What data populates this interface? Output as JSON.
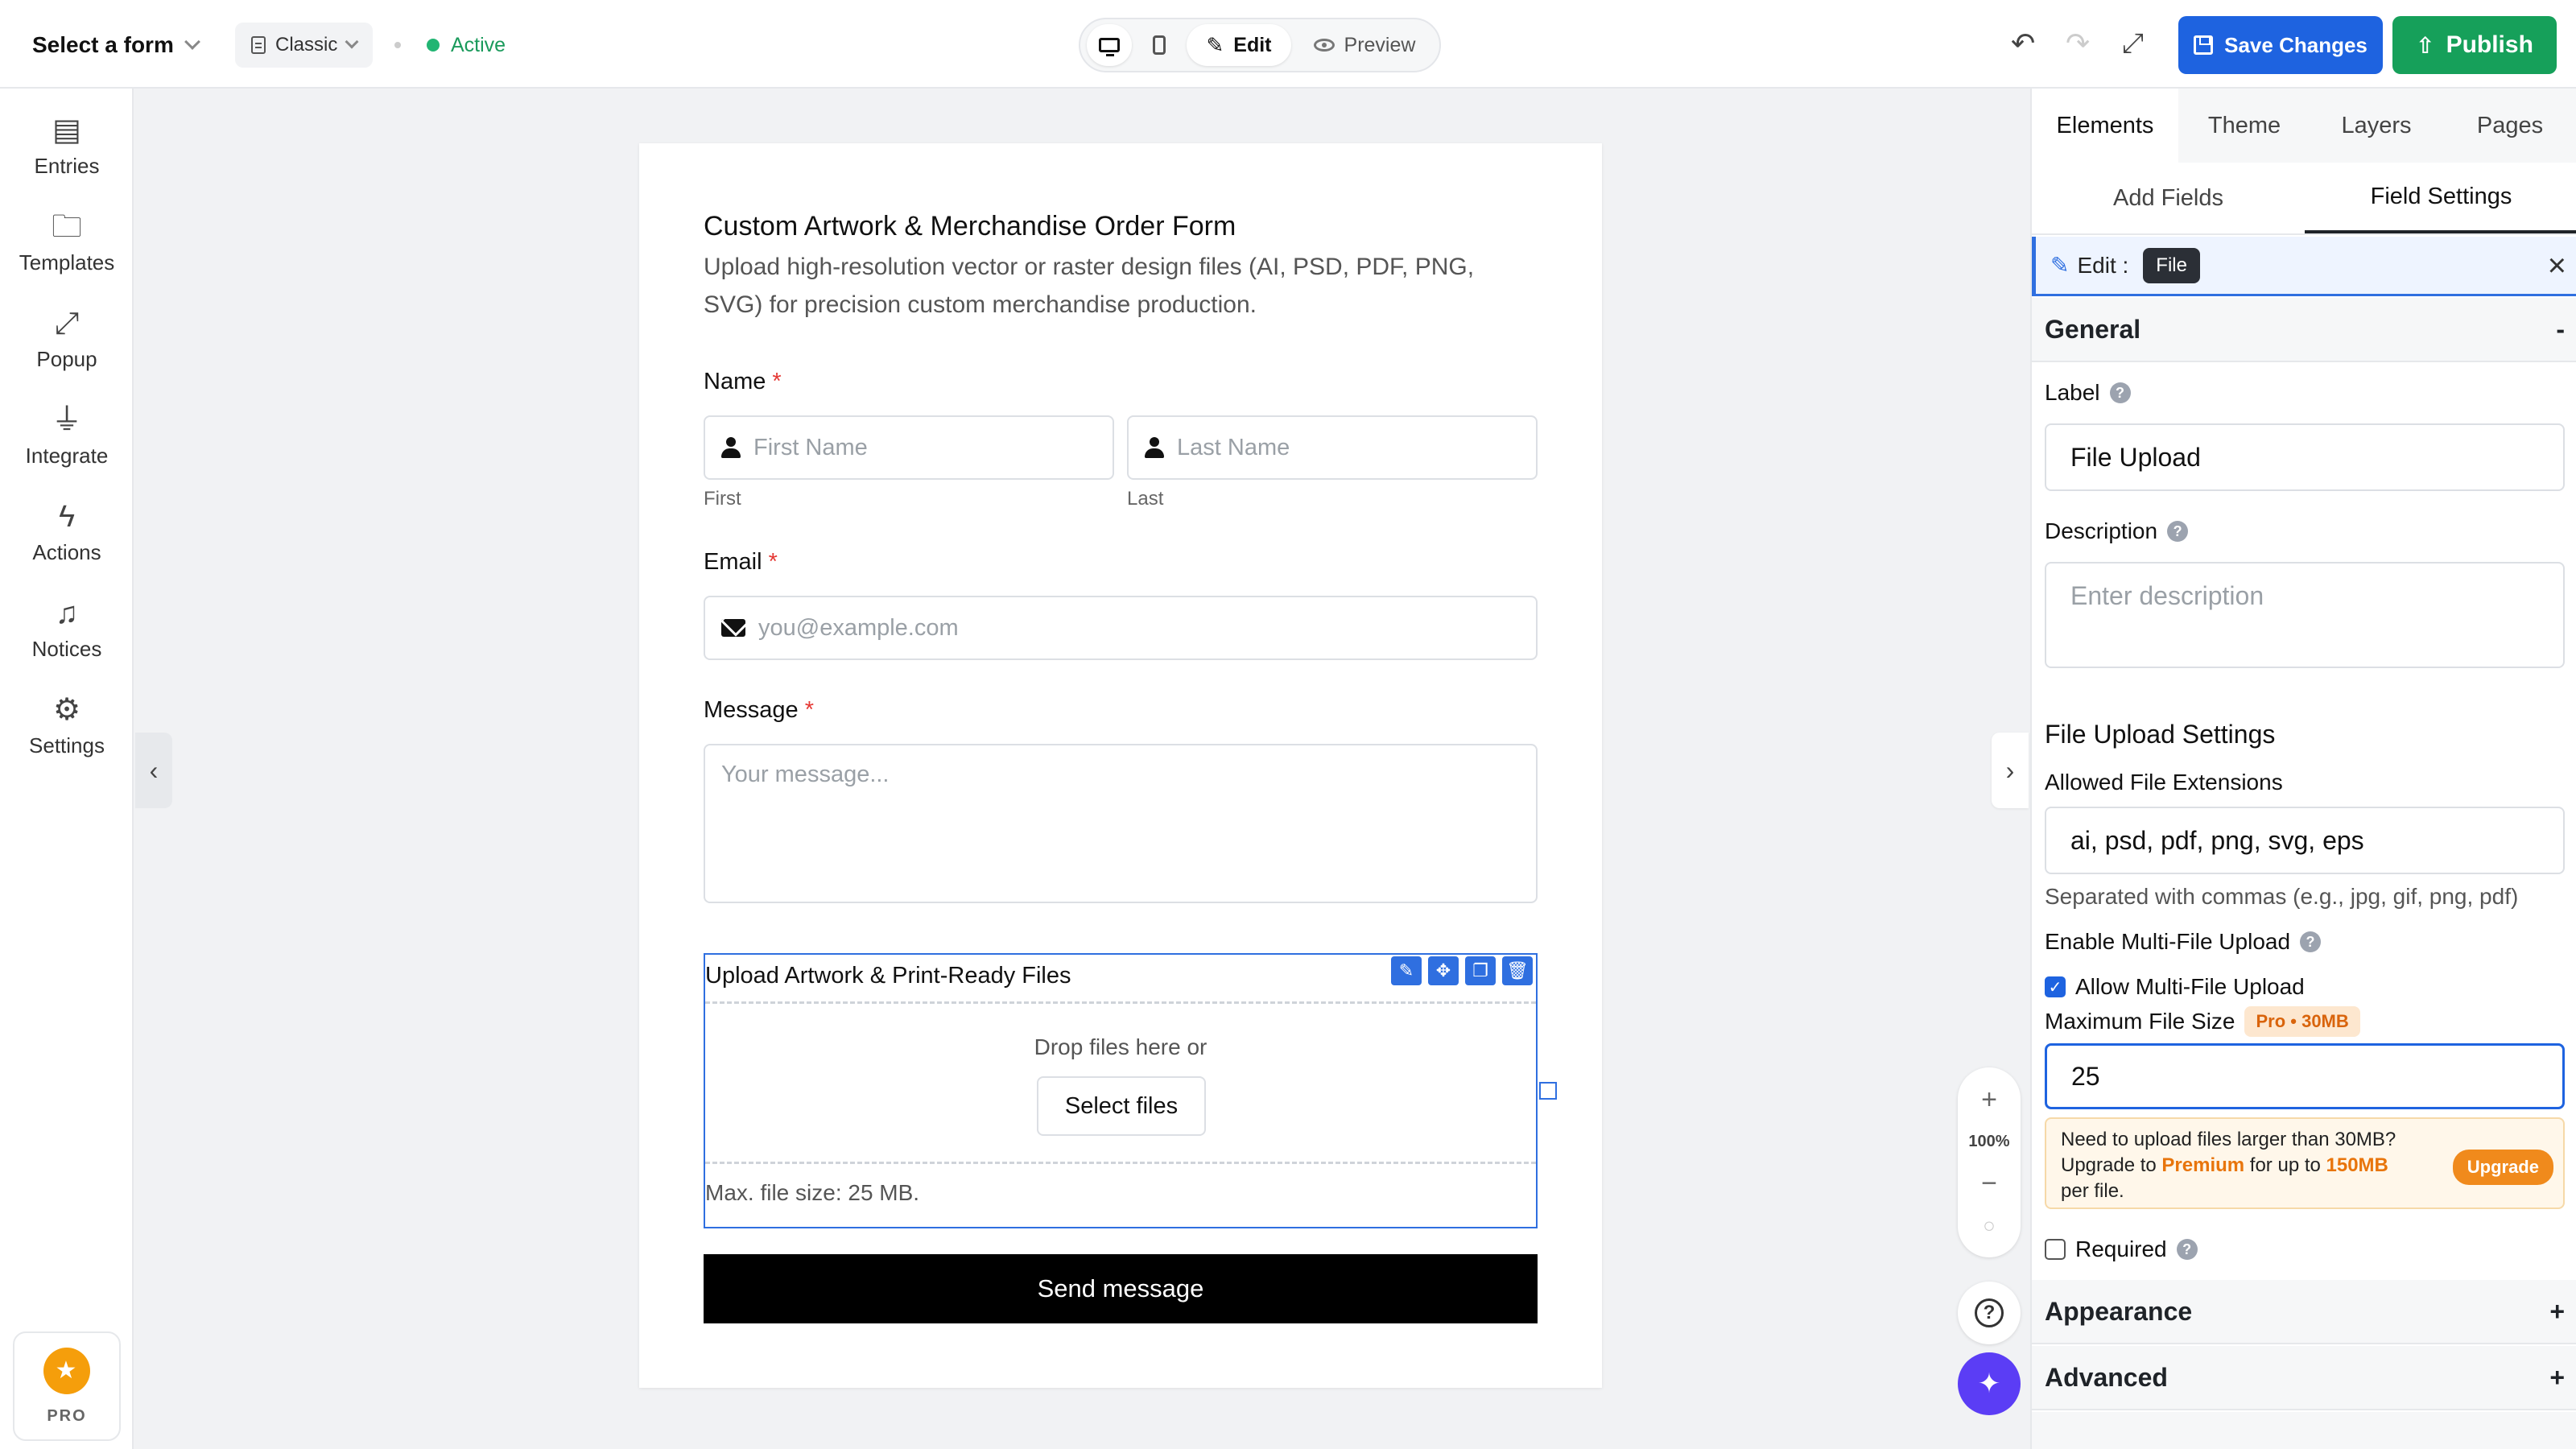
{
  "topbar": {
    "form_select": "Select a form",
    "layout_mode": "Classic",
    "status": "Active",
    "edit_label": "Edit",
    "preview_label": "Preview",
    "save_label": "Save Changes",
    "publish_label": "Publish"
  },
  "sidebar": {
    "items": [
      {
        "label": "Entries",
        "icon": "entries-icon"
      },
      {
        "label": "Templates",
        "icon": "folder-icon"
      },
      {
        "label": "Popup",
        "icon": "expand-icon"
      },
      {
        "label": "Integrate",
        "icon": "plug-icon"
      },
      {
        "label": "Actions",
        "icon": "bolt-icon"
      },
      {
        "label": "Notices",
        "icon": "bell-icon"
      },
      {
        "label": "Settings",
        "icon": "gear-icon"
      }
    ],
    "pro_label": "PRO"
  },
  "form": {
    "title": "Custom Artwork & Merchandise Order Form",
    "description": "Upload high-resolution vector or raster design files (AI, PSD, PDF, PNG, SVG) for precision custom merchandise production.",
    "name_label": "Name",
    "first_placeholder": "First Name",
    "last_placeholder": "Last Name",
    "first_sub": "First",
    "last_sub": "Last",
    "email_label": "Email",
    "email_placeholder": "you@example.com",
    "message_label": "Message",
    "message_placeholder": "Your message...",
    "upload_title": "Upload Artwork & Print-Ready Files",
    "drop_text": "Drop files here or",
    "select_files": "Select files",
    "max_size": "Max. file size: 25 MB.",
    "submit": "Send message",
    "required_mark": "*"
  },
  "zoom": {
    "plus": "+",
    "value": "100%",
    "minus": "−"
  },
  "panel": {
    "tabs": [
      "Elements",
      "Theme",
      "Layers",
      "Pages"
    ],
    "subtabs": [
      "Add Fields",
      "Field Settings"
    ],
    "edit_prefix": "Edit :",
    "edit_tag": "File",
    "general": "General",
    "general_toggle": "-",
    "label_label": "Label",
    "label_value": "File Upload",
    "description_label": "Description",
    "description_placeholder": "Enter description",
    "file_settings_title": "File Upload Settings",
    "allowed_ext_label": "Allowed File Extensions",
    "allowed_ext_value": "ai, psd, pdf, png, svg, eps",
    "allowed_ext_help": "Separated with commas (e.g., jpg, gif, png, pdf)",
    "multi_label": "Enable Multi-File Upload",
    "multi_checkbox": "Allow Multi-File Upload",
    "max_size_label": "Maximum File Size",
    "max_size_badge": "Pro • 30MB",
    "max_size_value": "25",
    "upsell_line1": "Need to upload files larger than 30MB?",
    "upsell_line2a": "Upgrade to ",
    "upsell_premium": "Premium",
    "upsell_line2b": " for up to ",
    "upsell_size": "150MB",
    "upsell_line3": "per file.",
    "upgrade_btn": "Upgrade",
    "required_label": "Required",
    "appearance": "Appearance",
    "advanced": "Advanced",
    "expand_symbol": "+"
  }
}
